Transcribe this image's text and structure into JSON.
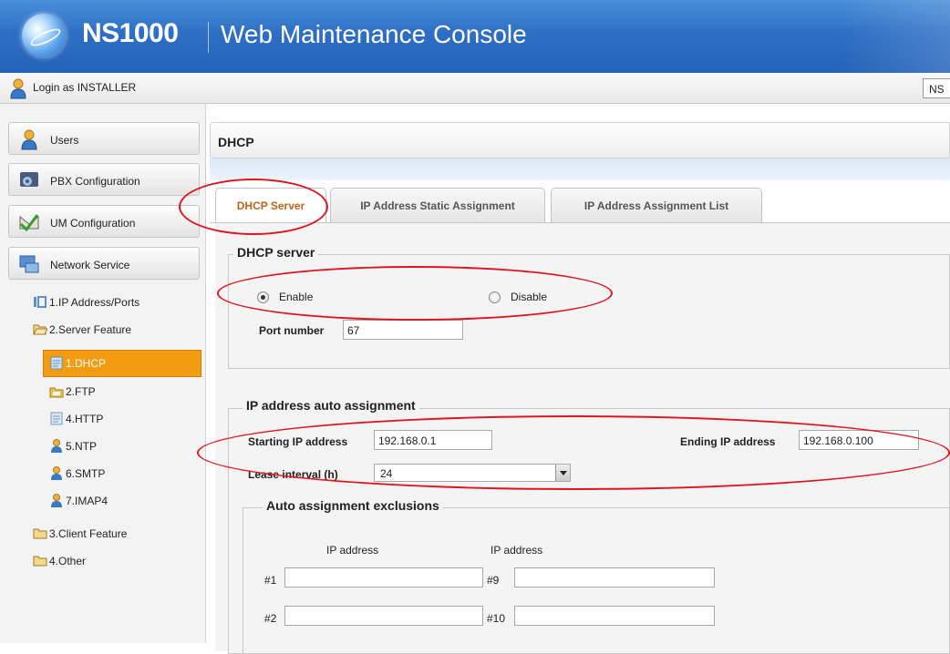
{
  "header": {
    "brand": "NS1000",
    "subtitle": "Web Maintenance Console"
  },
  "loginbar": {
    "text": "Login as INSTALLER",
    "right_box": "NS"
  },
  "sidebar": {
    "menus": [
      {
        "label": "Users",
        "icon": "user-icon"
      },
      {
        "label": "PBX Configuration",
        "icon": "pbx-icon"
      },
      {
        "label": "UM Configuration",
        "icon": "um-icon"
      },
      {
        "label": "Network Service",
        "icon": "network-icon"
      }
    ],
    "tree": [
      {
        "label": "1.IP Address/Ports",
        "icon": "ip-icon"
      },
      {
        "label": "2.Server Feature",
        "icon": "folder-open-icon"
      },
      {
        "label": "1.DHCP",
        "icon": "dhcp-icon",
        "selected": true
      },
      {
        "label": "2.FTP",
        "icon": "ftp-icon"
      },
      {
        "label": "4.HTTP",
        "icon": "http-icon"
      },
      {
        "label": "5.NTP",
        "icon": "ntp-icon"
      },
      {
        "label": "6.SMTP",
        "icon": "smtp-icon"
      },
      {
        "label": "7.IMAP4",
        "icon": "imap-icon"
      },
      {
        "label": "3.Client Feature",
        "icon": "folder-icon"
      },
      {
        "label": "4.Other",
        "icon": "folder-icon"
      }
    ]
  },
  "main": {
    "title": "DHCP",
    "tabs": [
      {
        "label": "DHCP Server",
        "active": true
      },
      {
        "label": "IP Address Static Assignment",
        "active": false
      },
      {
        "label": "IP Address Assignment List",
        "active": false
      }
    ],
    "dhcp_server": {
      "legend": "DHCP server",
      "enable_label": "Enable",
      "disable_label": "Disable",
      "selected": "Enable",
      "port_label": "Port number",
      "port_value": "67"
    },
    "auto_assign": {
      "legend": "IP address auto assignment",
      "start_label": "Starting IP address",
      "start_value": "192.168.0.1",
      "end_label": "Ending IP address",
      "end_value": "192.168.0.100",
      "lease_label": "Lease interval (h)",
      "lease_value": "24",
      "exclusions": {
        "legend": "Auto assignment exclusions",
        "col1_header": "IP address",
        "col2_header": "IP address",
        "rows": [
          {
            "left_no": "#1",
            "left_value": "",
            "right_no": "#9",
            "right_value": ""
          },
          {
            "left_no": "#2",
            "left_value": "",
            "right_no": "#10",
            "right_value": ""
          }
        ]
      }
    }
  },
  "colors": {
    "header_blue": "#2e6fc4",
    "selected_orange": "#f39c12",
    "annotation_red": "#e0141e",
    "active_tab_text": "#c0641a"
  }
}
